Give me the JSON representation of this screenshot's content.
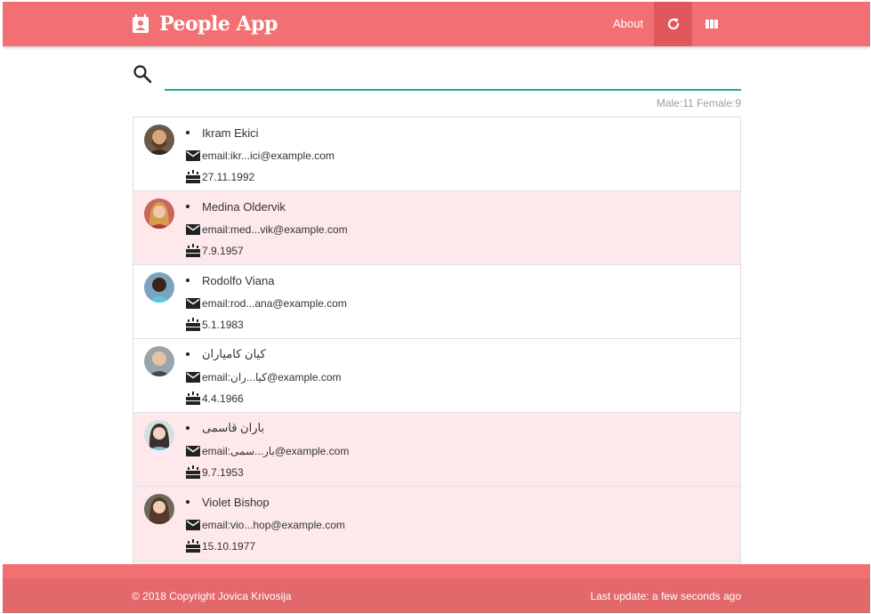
{
  "navbar": {
    "brand_title": "People App",
    "about_label": "About",
    "colors": {
      "bg": "#f27073",
      "active": "#e0585c"
    },
    "icons": [
      "contact-card-icon",
      "refresh-icon",
      "view-columns-icon"
    ]
  },
  "search": {
    "value": "",
    "placeholder": "",
    "icon": "search-icon"
  },
  "stats": {
    "text": "Male:11 Female:9"
  },
  "people": [
    {
      "name": "Ikram Ekici",
      "email": "email:ikr...ici@example.com",
      "birthday": "27.11.1992",
      "gender": "male"
    },
    {
      "name": "Medina Oldervik",
      "email": "email:med...vik@example.com",
      "birthday": "7.9.1957",
      "gender": "female"
    },
    {
      "name": "Rodolfo Viana",
      "email": "email:rod...ana@example.com",
      "birthday": "5.1.1983",
      "gender": "male"
    },
    {
      "name": "کیان کامیاران",
      "email": "email:کیا...ران@example.com",
      "birthday": "4.4.1966",
      "gender": "male"
    },
    {
      "name": "باران قاسمی",
      "email": "email:بار...سمی@example.com",
      "birthday": "9.7.1953",
      "gender": "female"
    },
    {
      "name": "Violet Bishop",
      "email": "email:vio...hop@example.com",
      "birthday": "15.10.1977",
      "gender": "female"
    }
  ],
  "footer": {
    "copyright": "© 2018 Copyright Jovica Krivosija",
    "last_update": "Last update: a few seconds ago"
  }
}
